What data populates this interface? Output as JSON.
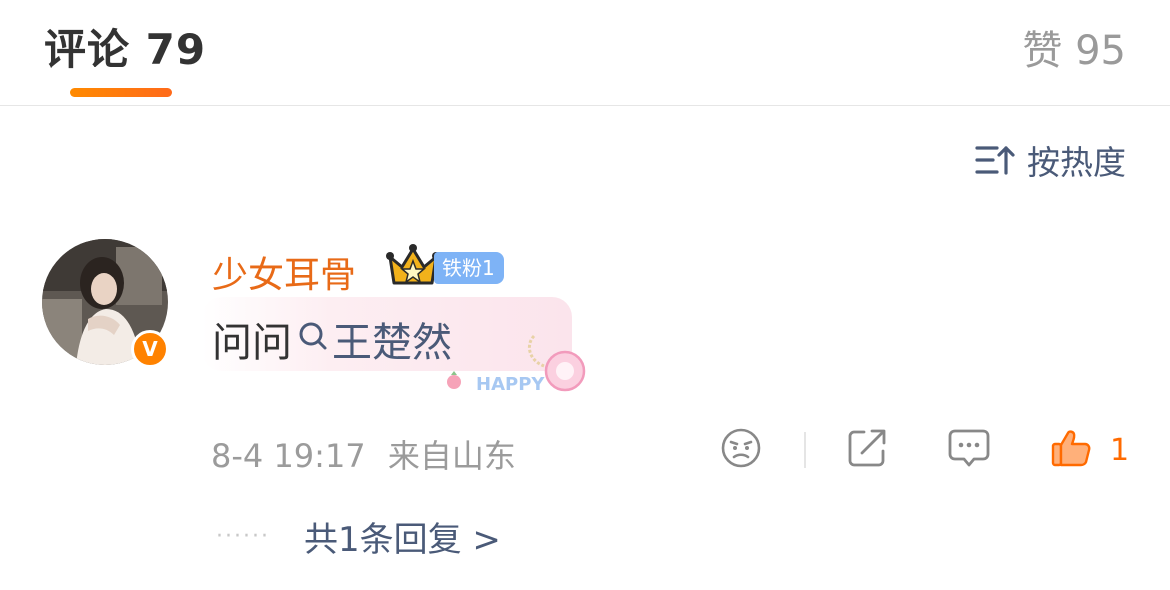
{
  "tabs": {
    "comments_label": "评论 79",
    "likes_label": "赞 95"
  },
  "sort": {
    "label": "按热度",
    "icon": "sort-icon"
  },
  "comment": {
    "username": "少女耳骨",
    "fan_badge": "铁粉1",
    "verified_mark": "V",
    "text_prefix": "问问",
    "topic": "王楚然",
    "decoration_text": "HAPPY",
    "time": "8-4 19:17",
    "location": "来自山东",
    "like_count": "1",
    "reply_summary": "共1条回复 >",
    "icons": [
      "dislike-icon",
      "share-icon",
      "comment-icon",
      "like-icon",
      "search-icon",
      "crown-icon"
    ]
  },
  "colors": {
    "accent_orange": "#ff8200",
    "username": "#e86a17",
    "link_blue": "#4a5a78",
    "fan_badge": "#7eb3f6",
    "muted": "#9b9b9b"
  }
}
